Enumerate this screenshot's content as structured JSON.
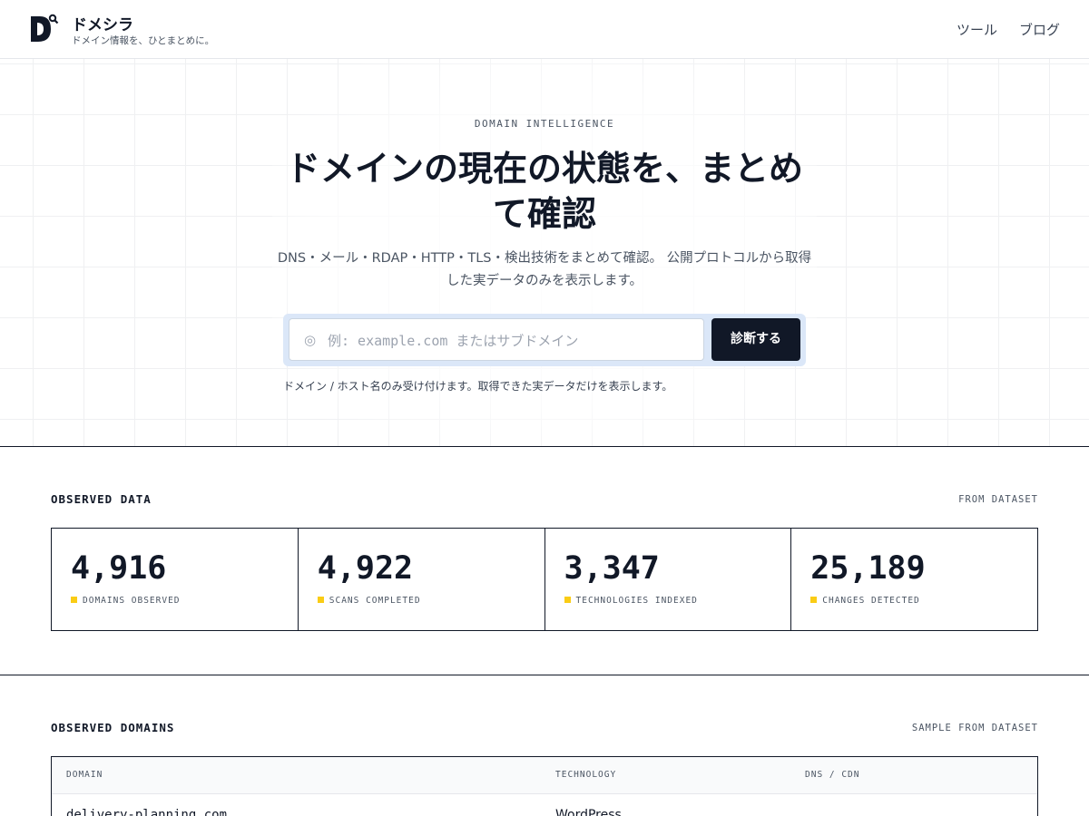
{
  "brand": {
    "name": "ドメシラ",
    "tagline": "ドメイン情報を、ひとまとめに。"
  },
  "nav": {
    "items": [
      {
        "label": "ツール"
      },
      {
        "label": "ブログ"
      }
    ]
  },
  "hero": {
    "eyebrow": "DOMAIN INTELLIGENCE",
    "title": "ドメインの現在の状態を、まとめて確認",
    "description": "DNS・メール・RDAP・HTTP・TLS・検出技術をまとめて確認。 公開プロトコルから取得した実データのみを表示します。",
    "search": {
      "placeholder": "例: example.com またはサブドメイン",
      "button_label": "診断する",
      "icon": "circle-icon"
    },
    "hint": "ドメイン / ホスト名のみ受け付けます。取得できた実データだけを表示します。"
  },
  "observed_data": {
    "heading": "OBSERVED DATA",
    "meta": "FROM DATASET",
    "stats": [
      {
        "value": "4,916",
        "label": "DOMAINS OBSERVED"
      },
      {
        "value": "4,922",
        "label": "SCANS COMPLETED"
      },
      {
        "value": "3,347",
        "label": "TECHNOLOGIES INDEXED"
      },
      {
        "value": "25,189",
        "label": "CHANGES DETECTED"
      }
    ]
  },
  "observed_domains": {
    "heading": "OBSERVED DOMAINS",
    "meta": "SAMPLE FROM DATASET",
    "columns": [
      "DOMAIN",
      "TECHNOLOGY",
      "DNS / CDN"
    ],
    "rows": [
      {
        "domain": "delivery-planning.com",
        "technology": "WordPress",
        "dns": ""
      }
    ]
  },
  "colors": {
    "accent": "#facc15",
    "primary": "#111827",
    "search_ring": "#dbe7f8"
  }
}
